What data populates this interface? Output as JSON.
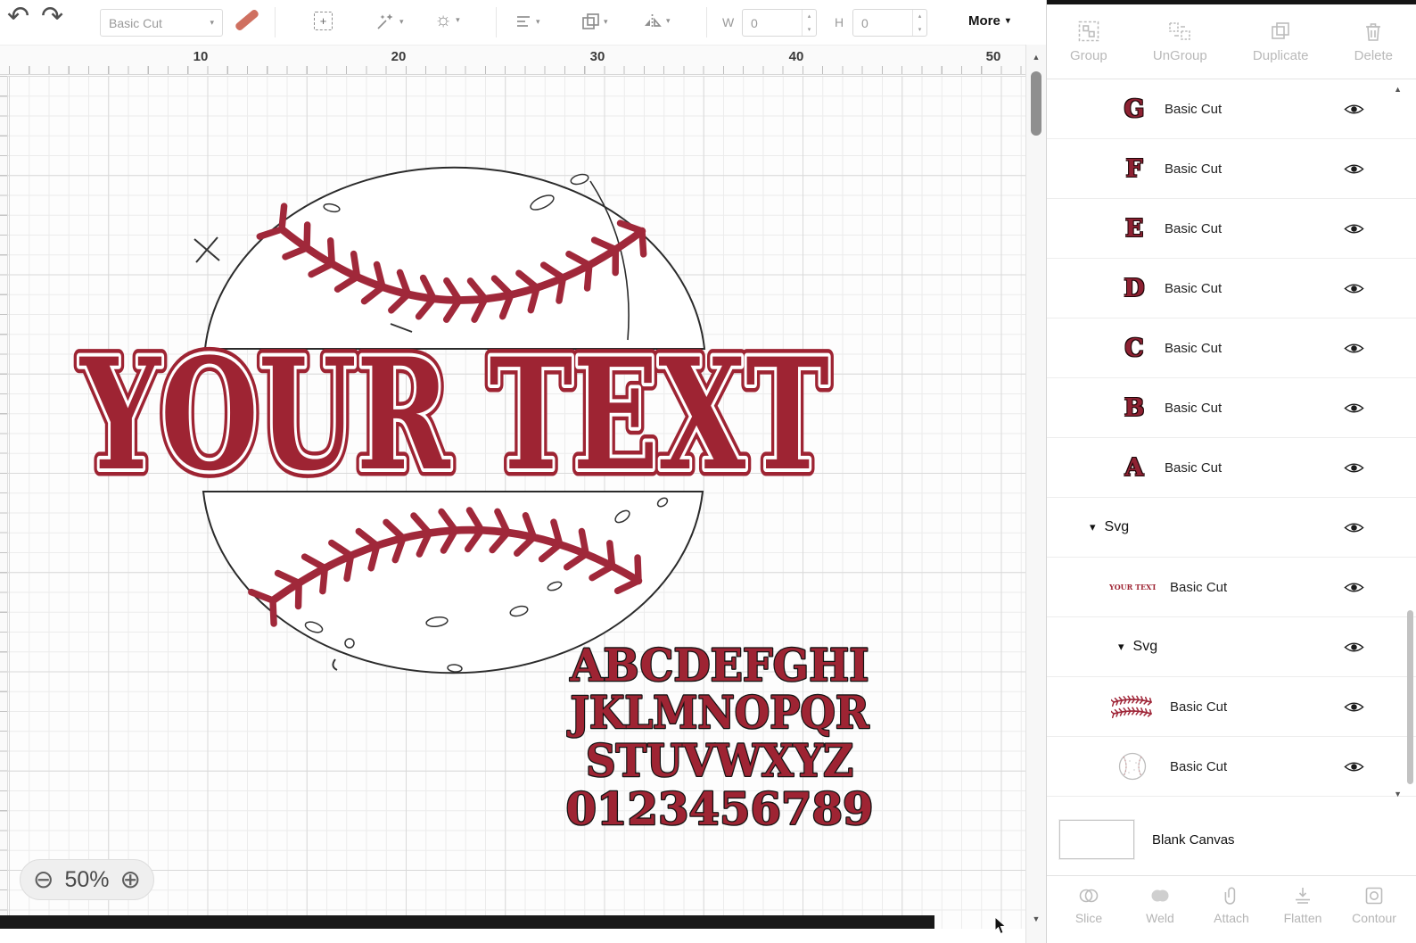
{
  "colors": {
    "accent_red": "#9e2433",
    "stitch_red": "#a0283a",
    "disabled_gray": "#b5b5b5"
  },
  "icons": {
    "undo": "↶",
    "redo": "↷",
    "caret_down": "▾",
    "sun": "☼",
    "plus": "+",
    "zoom_out": "⊖",
    "zoom_in": "⊕",
    "up_arrow": "▲",
    "down_arrow": "▼",
    "spin_up": "▴",
    "spin_down": "▾"
  },
  "toolbar": {
    "linetype_label": "Basic Cut",
    "w_label": "W",
    "w_value": "0",
    "h_label": "H",
    "h_value": "0",
    "more_label": "More"
  },
  "ruler": {
    "labels": [
      "10",
      "20",
      "30",
      "40",
      "50"
    ]
  },
  "canvas": {
    "design_text": "YOUR TEXT",
    "alphabet": [
      "ABCDEFGHI",
      "JKLMNOPQR",
      "STUVWXYZ",
      "0123456789"
    ],
    "zoom_level": "50%"
  },
  "layers_panel": {
    "header_actions": [
      "Group",
      "UnGroup",
      "Duplicate",
      "Delete"
    ],
    "rows": [
      {
        "thumb": "G",
        "label": "Basic Cut"
      },
      {
        "thumb": "F",
        "label": "Basic Cut"
      },
      {
        "thumb": "E",
        "label": "Basic Cut"
      },
      {
        "thumb": "D",
        "label": "Basic Cut"
      },
      {
        "thumb": "C",
        "label": "Basic Cut"
      },
      {
        "thumb": "B",
        "label": "Basic Cut"
      },
      {
        "thumb": "A",
        "label": "Basic Cut"
      },
      {
        "label": "Svg"
      },
      {
        "thumb": "YOUR TEXT",
        "label": "Basic Cut"
      },
      {
        "label": "Svg"
      },
      {
        "thumb": "stitches",
        "label": "Basic Cut"
      },
      {
        "thumb": "baseball",
        "label": "Basic Cut"
      }
    ],
    "blank_canvas_label": "Blank Canvas",
    "footer_actions": [
      "Slice",
      "Weld",
      "Attach",
      "Flatten",
      "Contour"
    ]
  }
}
